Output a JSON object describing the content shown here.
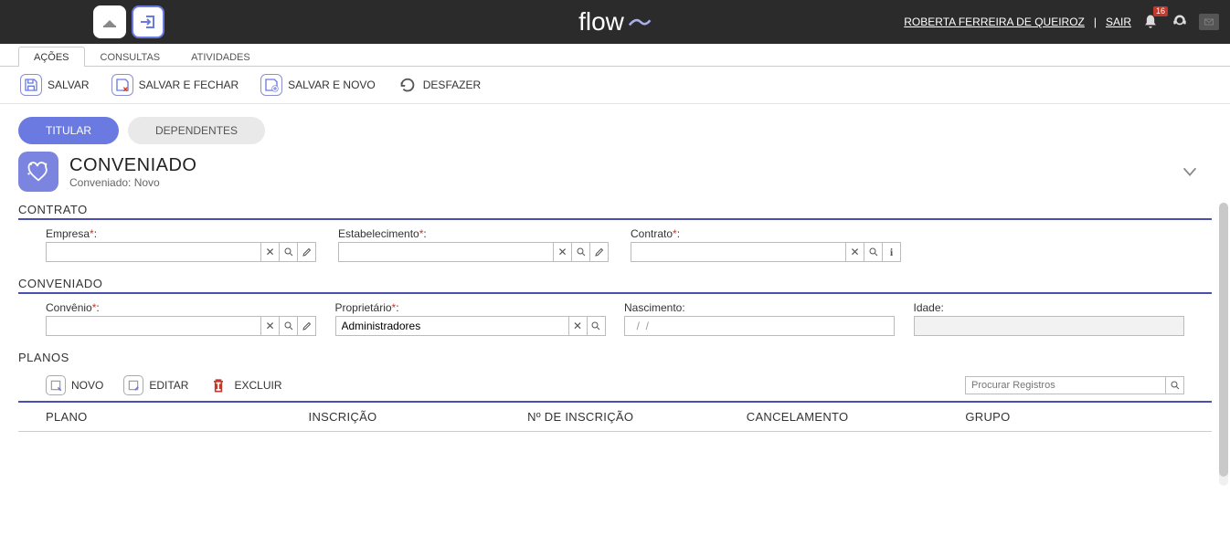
{
  "topbar": {
    "user_name": "ROBERTA FERREIRA DE QUEIROZ",
    "logout_label": "SAIR",
    "notification_count": "16",
    "logo_text": "flow"
  },
  "main_tabs": {
    "acoes": "AÇÕES",
    "consultas": "CONSULTAS",
    "atividades": "ATIVIDADES"
  },
  "actions": {
    "salvar": "SALVAR",
    "salvar_fechar": "SALVAR E FECHAR",
    "salvar_novo": "SALVAR E NOVO",
    "desfazer": "DESFAZER"
  },
  "pill_tabs": {
    "titular": "TITULAR",
    "dependentes": "DEPENDENTES"
  },
  "entity": {
    "title": "CONVENIADO",
    "subtitle": "Conveniado: Novo"
  },
  "sections": {
    "contrato": "CONTRATO",
    "conveniado": "CONVENIADO",
    "planos": "PLANOS"
  },
  "fields": {
    "empresa": {
      "label": "Empresa",
      "value": ""
    },
    "estabelecimento": {
      "label": "Estabelecimento",
      "value": ""
    },
    "contrato": {
      "label": "Contrato",
      "value": ""
    },
    "convenio": {
      "label": "Convênio",
      "value": ""
    },
    "proprietario": {
      "label": "Proprietário",
      "value": "Administradores"
    },
    "nascimento": {
      "label": "Nascimento:",
      "value": "  /  /"
    },
    "idade": {
      "label": "Idade:",
      "value": ""
    }
  },
  "planos": {
    "novo": "NOVO",
    "editar": "EDITAR",
    "excluir": "EXCLUIR",
    "search_placeholder": "Procurar Registros"
  },
  "columns": {
    "plano": "PLANO",
    "inscricao": "INSCRIÇÃO",
    "no_inscricao": "Nº DE INSCRIÇÃO",
    "cancelamento": "CANCELAMENTO",
    "grupo": "GRUPO"
  }
}
